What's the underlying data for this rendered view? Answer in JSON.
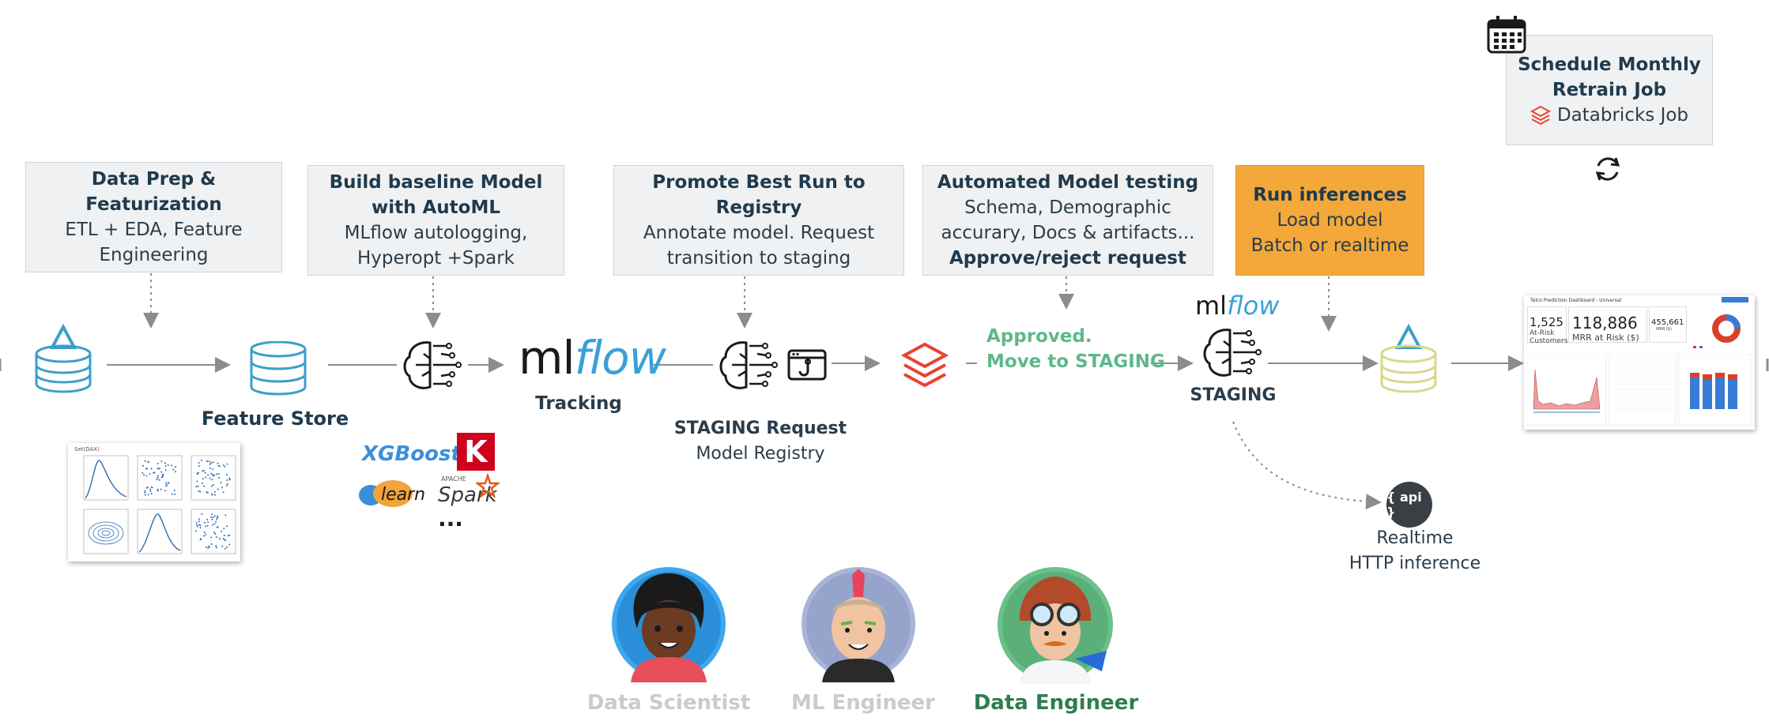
{
  "steps": [
    {
      "title": "Data Prep &\nFeaturization",
      "sub": "ETL + EDA, Feature\nEngineering"
    },
    {
      "title": "Build baseline Model\nwith AutoML",
      "sub": "MLflow autologging,\nHyperopt +Spark"
    },
    {
      "title": "Promote Best Run to\nRegistry",
      "sub": "Annotate model. Request\ntransition to staging"
    },
    {
      "title": "Automated Model testing",
      "sub": "Schema, Demographic\naccurary, Docs & artifacts...",
      "bold": "Approve/reject request"
    },
    {
      "title": "Run inferences",
      "sub": "Load model\nBatch or realtime"
    },
    {
      "title": "Schedule Monthly\nRetrain Job",
      "sub": "Databricks Job"
    }
  ],
  "labels": {
    "feature_store": "Feature Store",
    "tracking": "Tracking",
    "mlflow_ml": "ml",
    "mlflow_flow": "flow",
    "staging_request": "STAGING Request",
    "model_registry": "Model Registry",
    "approved_line1": "Approved.",
    "approved_line2": "Move to STAGING",
    "staging": "STAGING",
    "api": "{ api }",
    "realtime_line1": "Realtime",
    "realtime_line2": "HTTP inference",
    "xgboost": "XGBoost",
    "keras": "K",
    "sklearn": "learn",
    "spark": "Spark",
    "apache": "APACHE",
    "ellipsis": "...",
    "plot_title": "Set(DAX)"
  },
  "dashboard": {
    "title": "Telco Prediction Dashboard - Universal",
    "kpi1_value": "1,525",
    "kpi1_label": "At-Risk Customers",
    "kpi2_value": "118,886",
    "kpi2_label": "MRR at Risk ($)",
    "kpi3_value": "455,661",
    "kpi3_label": "MRR ($)"
  },
  "personas": [
    {
      "name": "Data Scientist",
      "color": "#c8cbcf"
    },
    {
      "name": "ML Engineer",
      "color": "#c8cbcf"
    },
    {
      "name": "Data Engineer",
      "color": "#2e7d4f"
    }
  ],
  "colors": {
    "delta_blue": "#3aa0c8",
    "delta_yellow": "#d6d98a",
    "databricks_red": "#e8432e",
    "approved_green": "#5db88a",
    "orange": "#f4a83a",
    "arrow": "#8c8c8c"
  }
}
